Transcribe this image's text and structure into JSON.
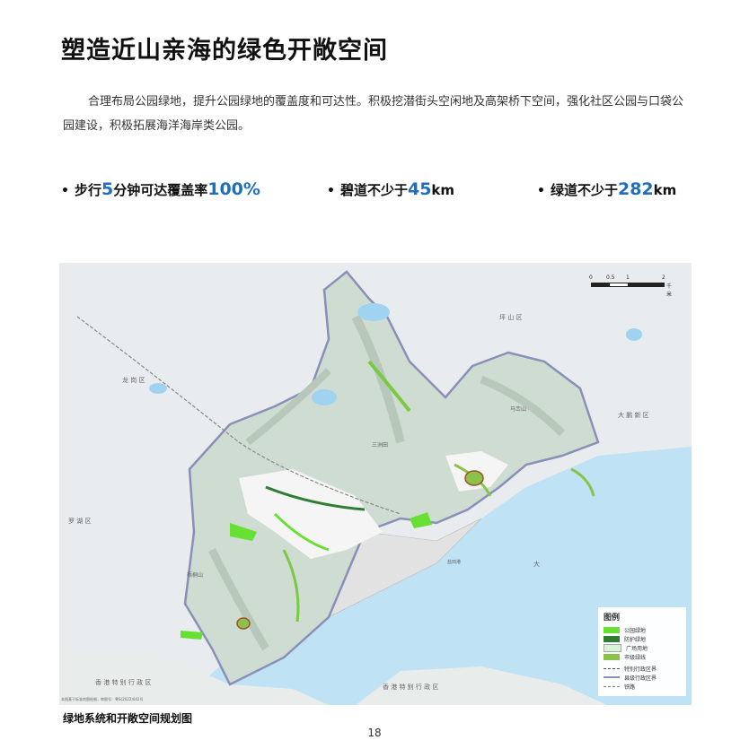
{
  "title": "塑造近山亲海的绿色开敞空间",
  "intro": "合理布局公园绿地，提升公园绿地的覆盖度和可达性。积极挖潜街头空闲地及高架桥下空间，强化社区公园与口袋公园建设，积极拓展海洋海岸类公园。",
  "metrics": [
    {
      "prefix": "步行",
      "num1": "5",
      "middle": "分钟可达覆盖率",
      "num2": "100%",
      "suffix": ""
    },
    {
      "prefix": "碧道不少于",
      "num1": "45",
      "middle": "km",
      "num2": "",
      "suffix": ""
    },
    {
      "prefix": "绿道不少于",
      "num1": "282",
      "middle": "km",
      "num2": "",
      "suffix": ""
    }
  ],
  "map": {
    "labels": {
      "pingshan": "坪 山 区",
      "longgang": "龙 岗 区",
      "luohu": "罗 湖 区",
      "dapeng": "大 鹏 新 区",
      "hk_left": "香 港 特 别 行 政 区",
      "hk_right": "香 港 特 别 行 政 区",
      "wutong": "梧桐山",
      "maluanshan": "马峦山",
      "sanzhoutian": "三洲田",
      "yantiangang": "盐田港",
      "dameisha": "大",
      "note": "本图基于标准地图绘制，审图号：粤S(2022)042号"
    },
    "scale": {
      "ticks": [
        "0",
        "0.5",
        "1",
        "2"
      ],
      "unit": "千米"
    },
    "legend": {
      "title": "图例",
      "items": [
        {
          "label": "公园绿地",
          "color": "#66e033"
        },
        {
          "label": "防护绿地",
          "color": "#2e7d32"
        },
        {
          "label": "广场用地",
          "color": "#d6f5d6"
        },
        {
          "label": "市级绿线",
          "color": "#8bc34a"
        }
      ],
      "lines": [
        {
          "label": "特别行政区界"
        },
        {
          "label": "县级行政区界"
        },
        {
          "label": "铁路"
        }
      ]
    }
  },
  "caption": "绿地系统和开敞空间规划图",
  "page_number": "18"
}
